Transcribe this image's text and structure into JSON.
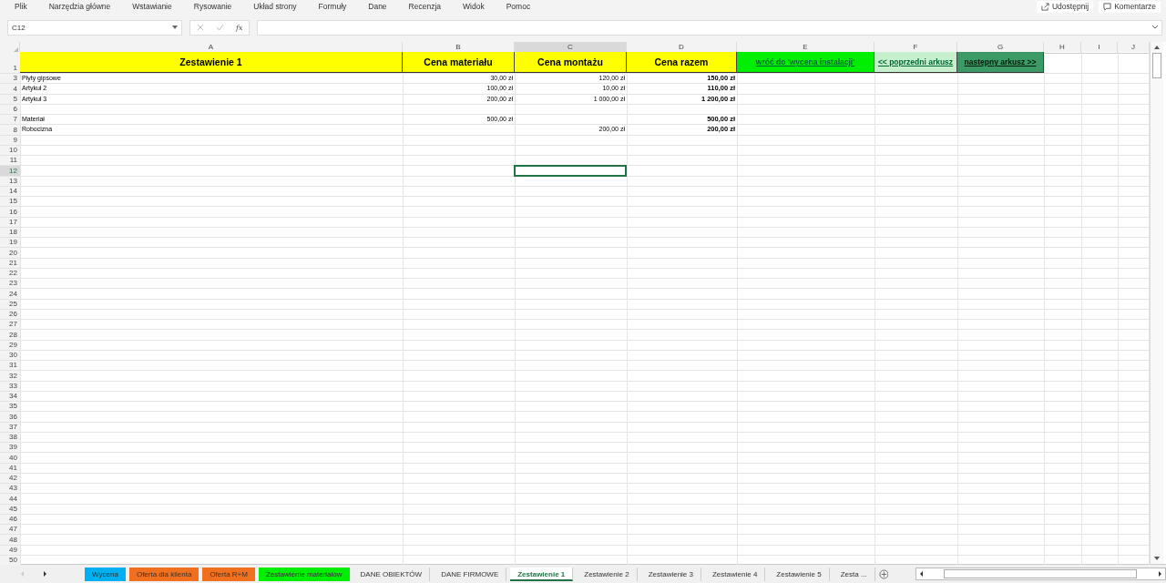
{
  "menu": [
    "Plik",
    "Narzędzia główne",
    "Wstawianie",
    "Rysowanie",
    "Układ strony",
    "Formuły",
    "Dane",
    "Recenzja",
    "Widok",
    "Pomoc"
  ],
  "ribbon_buttons": [
    {
      "label": "Udostępnij",
      "kind": "share"
    },
    {
      "label": "Komentarze",
      "kind": "comment"
    }
  ],
  "formula_bar": {
    "name_box": "C12",
    "function_label": "fx"
  },
  "columns": [
    {
      "label": "A",
      "selected": false
    },
    {
      "label": "B",
      "selected": false
    },
    {
      "label": "C",
      "selected": true
    },
    {
      "label": "D",
      "selected": false
    },
    {
      "label": "E",
      "selected": false
    },
    {
      "label": "F",
      "selected": false
    },
    {
      "label": "G",
      "selected": false
    },
    {
      "label": "H",
      "selected": false
    },
    {
      "label": "I",
      "selected": false
    },
    {
      "label": "J",
      "selected": false
    }
  ],
  "header_row": {
    "number": "1",
    "cells": [
      {
        "text": "Zestawienie 1",
        "kind": "header",
        "color": "#ffff00"
      },
      {
        "text": "Cena materiału",
        "kind": "header",
        "color": "#ffff00"
      },
      {
        "text": "Cena montażu",
        "kind": "header",
        "color": "#ffff00"
      },
      {
        "text": "Cena razem",
        "kind": "header",
        "color": "#ffff00"
      },
      {
        "text": "wróć do 'wycena instalacji'",
        "kind": "link",
        "color": "#00ee00"
      },
      {
        "text": "<< poprzedni arkusz",
        "kind": "link",
        "color": "#c6efce"
      },
      {
        "text": "następny arkusz  >>",
        "kind": "link",
        "color": "#3c9a66"
      }
    ]
  },
  "rows": [
    {
      "number": "3",
      "selected": false,
      "a": "Płyty gipsowe",
      "b": "30,00 zł",
      "c": "120,00 zł",
      "d": "150,00 zł"
    },
    {
      "number": "4",
      "selected": false,
      "a": "Artykuł 2",
      "b": "100,00 zł",
      "c": "10,00 zł",
      "d": "110,00 zł"
    },
    {
      "number": "5",
      "selected": false,
      "a": "Artykuł 3",
      "b": "200,00 zł",
      "c": "1 000,00 zł",
      "d": "1 200,00 zł"
    },
    {
      "number": "6",
      "selected": false
    },
    {
      "number": "7",
      "selected": false,
      "a": "Materiał",
      "b": "500,00 zł",
      "d": "500,00 zł"
    },
    {
      "number": "8",
      "selected": false,
      "a": "Robocizna",
      "c": "200,00 zł",
      "d": "200,00 zł"
    },
    {
      "number": "9",
      "selected": false
    },
    {
      "number": "10",
      "selected": false
    },
    {
      "number": "11",
      "selected": false
    },
    {
      "number": "12",
      "selected": true
    },
    {
      "number": "13",
      "selected": false
    },
    {
      "number": "14",
      "selected": false
    },
    {
      "number": "15",
      "selected": false
    },
    {
      "number": "16",
      "selected": false
    },
    {
      "number": "17",
      "selected": false
    },
    {
      "number": "18",
      "selected": false
    },
    {
      "number": "19",
      "selected": false
    },
    {
      "number": "20",
      "selected": false
    },
    {
      "number": "21",
      "selected": false
    },
    {
      "number": "22",
      "selected": false
    },
    {
      "number": "23",
      "selected": false
    },
    {
      "number": "24",
      "selected": false
    },
    {
      "number": "25",
      "selected": false
    },
    {
      "number": "26",
      "selected": false
    },
    {
      "number": "27",
      "selected": false
    },
    {
      "number": "28",
      "selected": false
    },
    {
      "number": "29",
      "selected": false
    },
    {
      "number": "30",
      "selected": false
    },
    {
      "number": "31",
      "selected": false
    },
    {
      "number": "32",
      "selected": false
    },
    {
      "number": "33",
      "selected": false
    },
    {
      "number": "34",
      "selected": false
    },
    {
      "number": "35",
      "selected": false
    },
    {
      "number": "36",
      "selected": false
    },
    {
      "number": "37",
      "selected": false
    },
    {
      "number": "38",
      "selected": false
    },
    {
      "number": "39",
      "selected": false
    },
    {
      "number": "40",
      "selected": false
    },
    {
      "number": "41",
      "selected": false
    },
    {
      "number": "42",
      "selected": false
    },
    {
      "number": "43",
      "selected": false
    },
    {
      "number": "44",
      "selected": false
    },
    {
      "number": "45",
      "selected": false
    },
    {
      "number": "46",
      "selected": false
    },
    {
      "number": "47",
      "selected": false
    },
    {
      "number": "48",
      "selected": false
    },
    {
      "number": "49",
      "selected": false
    },
    {
      "number": "50",
      "selected": false
    }
  ],
  "sheet_tabs": [
    {
      "label": "Wycena",
      "selected": false,
      "color": "#00b0f0"
    },
    {
      "label": "Oferta dla klienta",
      "selected": false,
      "color": "#f07020"
    },
    {
      "label": "Oferta R+M",
      "selected": false,
      "color": "#f07020"
    },
    {
      "label": "Zestawienie materiałów",
      "selected": false,
      "color": "#00ee00"
    },
    {
      "label": "DANE OBIEKTÓW",
      "selected": false
    },
    {
      "label": "DANE FIRMOWE",
      "selected": false
    },
    {
      "label": "Zestawienie 1",
      "selected": true
    },
    {
      "label": "Zestawienie 2",
      "selected": false
    },
    {
      "label": "Zestawienie 3",
      "selected": false
    },
    {
      "label": "Zestawienie 4",
      "selected": false
    },
    {
      "label": "Zestawienie 5",
      "selected": false
    },
    {
      "label": "Zesta ...",
      "selected": false
    }
  ]
}
